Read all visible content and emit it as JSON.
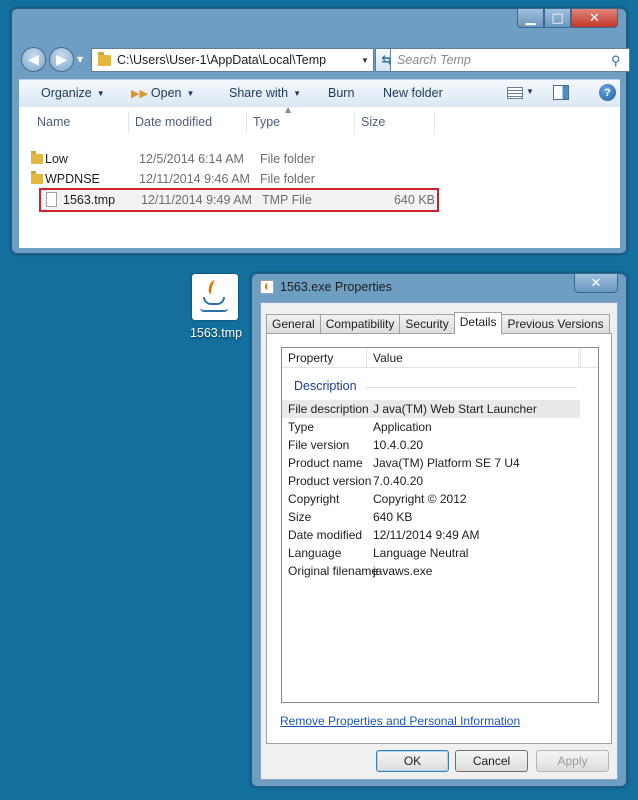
{
  "explorer": {
    "address": "C:\\Users\\User-1\\AppData\\Local\\Temp",
    "search_placeholder": "Search Temp",
    "toolbar": {
      "organize": "Organize",
      "open": "Open",
      "share_with": "Share with",
      "burn": "Burn",
      "new_folder": "New folder"
    },
    "columns": {
      "name": "Name",
      "date": "Date modified",
      "type": "Type",
      "size": "Size"
    },
    "files": [
      {
        "name": "Low",
        "date": "12/5/2014 6:14 AM",
        "type": "File folder",
        "size": ""
      },
      {
        "name": "WPDNSE",
        "date": "12/11/2014 9:46 AM",
        "type": "File folder",
        "size": ""
      },
      {
        "name": "1563.tmp",
        "date": "12/11/2014 9:49 AM",
        "type": "TMP File",
        "size": "640 KB"
      }
    ]
  },
  "desktop_icon": {
    "label": "1563.tmp",
    "icon": "java-icon"
  },
  "dialog": {
    "title": "1563.exe Properties",
    "tabs": [
      "General",
      "Compatibility",
      "Security",
      "Details",
      "Previous Versions"
    ],
    "active_tab": "Details",
    "columns": {
      "property": "Property",
      "value": "Value"
    },
    "section": "Description",
    "properties": [
      {
        "key": "File description",
        "value": "J ava(TM) Web Start Launcher"
      },
      {
        "key": "Type",
        "value": "Application"
      },
      {
        "key": "File version",
        "value": "10.4.0.20"
      },
      {
        "key": "Product name",
        "value": "Java(TM) Platform SE 7 U4"
      },
      {
        "key": "Product version",
        "value": "7.0.40.20"
      },
      {
        "key": "Copyright",
        "value": "Copyright © 2012"
      },
      {
        "key": "Size",
        "value": "640 KB"
      },
      {
        "key": "Date modified",
        "value": "12/11/2014 9:49 AM"
      },
      {
        "key": "Language",
        "value": "Language Neutral"
      },
      {
        "key": "Original filename",
        "value": "javaws.exe"
      }
    ],
    "remove_link": "Remove Properties and Personal Information",
    "buttons": {
      "ok": "OK",
      "cancel": "Cancel",
      "apply": "Apply"
    }
  },
  "colors": {
    "desktop": "#136f9e",
    "selection_outline": "#d0202a",
    "link": "#1a56b8"
  }
}
